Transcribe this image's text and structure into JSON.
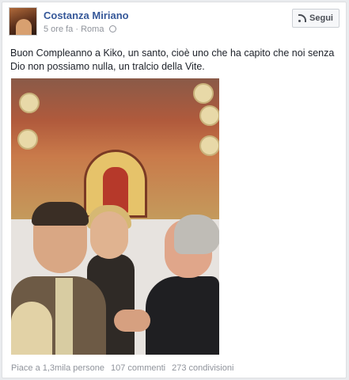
{
  "post": {
    "author": "Costanza Miriano",
    "time": "5 ore fa",
    "separator": "·",
    "location": "Roma",
    "follow_label": "Segui",
    "text": "Buon Compleanno a Kiko, un santo, cioè uno che ha capito che noi senza Dio non possiamo nulla, un tralcio della Vite."
  },
  "stats": {
    "likes": "Piace a 1,3mila persone",
    "comments": "107 commenti",
    "shares": "273 condivisioni"
  },
  "icons": {
    "follow": "rss-icon",
    "privacy": "globe-icon"
  },
  "colors": {
    "author": "#365899",
    "meta": "#90949c"
  }
}
